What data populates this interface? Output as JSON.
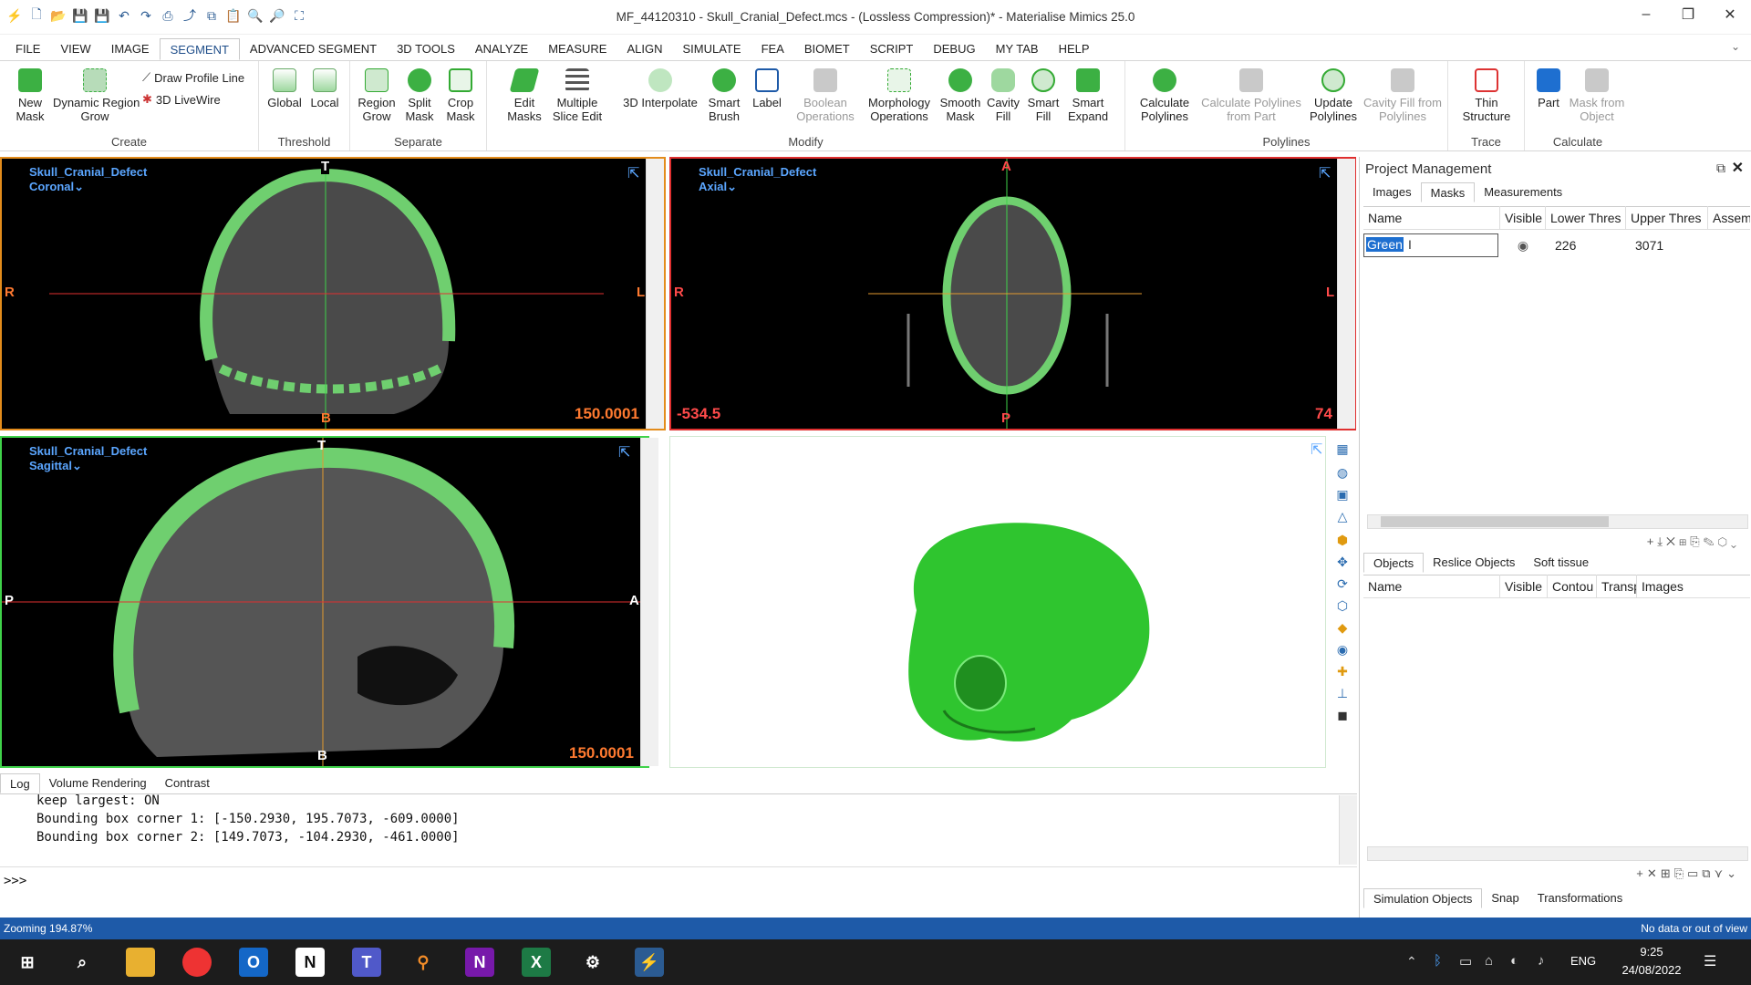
{
  "window": {
    "title": "MF_44120310 - Skull_Cranial_Defect.mcs - (Lossless Compression)* - Materialise Mimics 25.0"
  },
  "menu": [
    "FILE",
    "VIEW",
    "IMAGE",
    "SEGMENT",
    "ADVANCED SEGMENT",
    "3D TOOLS",
    "ANALYZE",
    "MEASURE",
    "ALIGN",
    "SIMULATE",
    "FEA",
    "BIOMET",
    "SCRIPT",
    "DEBUG",
    "MY TAB",
    "HELP"
  ],
  "ribbon": {
    "create": {
      "label": "Create",
      "new_mask": "New\nMask",
      "dynamic": "Dynamic Region\nGrow",
      "draw_profile": "Draw Profile Line",
      "livewire": "3D LiveWire"
    },
    "threshold": {
      "label": "Threshold",
      "global": "Global",
      "local": "Local"
    },
    "separate": {
      "label": "Separate",
      "region_grow": "Region\nGrow",
      "split_mask": "Split\nMask",
      "crop_mask": "Crop\nMask"
    },
    "modify": {
      "label": "Modify",
      "edit_masks": "Edit\nMasks",
      "multiple": "Multiple\nSlice Edit",
      "interp": "3D Interpolate",
      "smart_brush": "Smart\nBrush",
      "labelb": "Label",
      "boolean": "Boolean\nOperations",
      "morph": "Morphology\nOperations",
      "smooth": "Smooth\nMask",
      "cavity": "Cavity\nFill",
      "smart_fill": "Smart\nFill",
      "smart_expand": "Smart\nExpand"
    },
    "polylines": {
      "label": "Polylines",
      "calc": "Calculate\nPolylines",
      "calc_part": "Calculate Polylines\nfrom Part",
      "update": "Update\nPolylines",
      "cavity_fill": "Cavity Fill from\nPolylines"
    },
    "trace": {
      "label": "Trace",
      "thin": "Thin\nStructure"
    },
    "calculate": {
      "label": "Calculate",
      "part": "Part",
      "mask_obj": "Mask from\nObject"
    }
  },
  "viewports": {
    "coronal": {
      "name": "Skull_Cranial_Defect",
      "view": "Coronal",
      "top": "T",
      "bottom": "B",
      "left": "R",
      "right": "L",
      "value": "150.0001"
    },
    "axial": {
      "name": "Skull_Cranial_Defect",
      "view": "Axial",
      "top": "A",
      "bottom": "P",
      "left": "R",
      "right": "L",
      "value_left": "-534.5",
      "value_right": "74"
    },
    "sagittal": {
      "name": "Skull_Cranial_Defect",
      "view": "Sagittal",
      "top": "T",
      "bottom": "B",
      "left": "P",
      "right": "A",
      "value": "150.0001"
    }
  },
  "project": {
    "title": "Project Management",
    "tabs": [
      "Images",
      "Masks",
      "Measurements"
    ],
    "columns": [
      "Name",
      "Visible",
      "Lower Thres",
      "Upper Thres",
      "Assem"
    ],
    "mask_row": {
      "name": "Green",
      "lower": "226",
      "upper": "3071"
    },
    "objects_tabs": [
      "Objects",
      "Reslice Objects",
      "Soft tissue"
    ],
    "objects_columns": [
      "Name",
      "Visible",
      "Contou",
      "Transp",
      "Images"
    ],
    "bottom_tabs": [
      "Simulation Objects",
      "Snap",
      "Transformations"
    ]
  },
  "log": {
    "tabs": [
      "Log",
      "Volume Rendering",
      "Contrast"
    ],
    "lines": [
      "keep largest: ON",
      "Bounding box corner 1: [-150.2930, 195.7073, -609.0000]",
      "Bounding box corner 2: [149.7073, -104.2930, -461.0000]"
    ],
    "prompt": ">>>"
  },
  "status": {
    "left": "Zooming 194.87%",
    "right": "No data or out of view"
  },
  "taskbar": {
    "lang": "ENG",
    "time": "9:25",
    "date": "24/08/2022"
  }
}
